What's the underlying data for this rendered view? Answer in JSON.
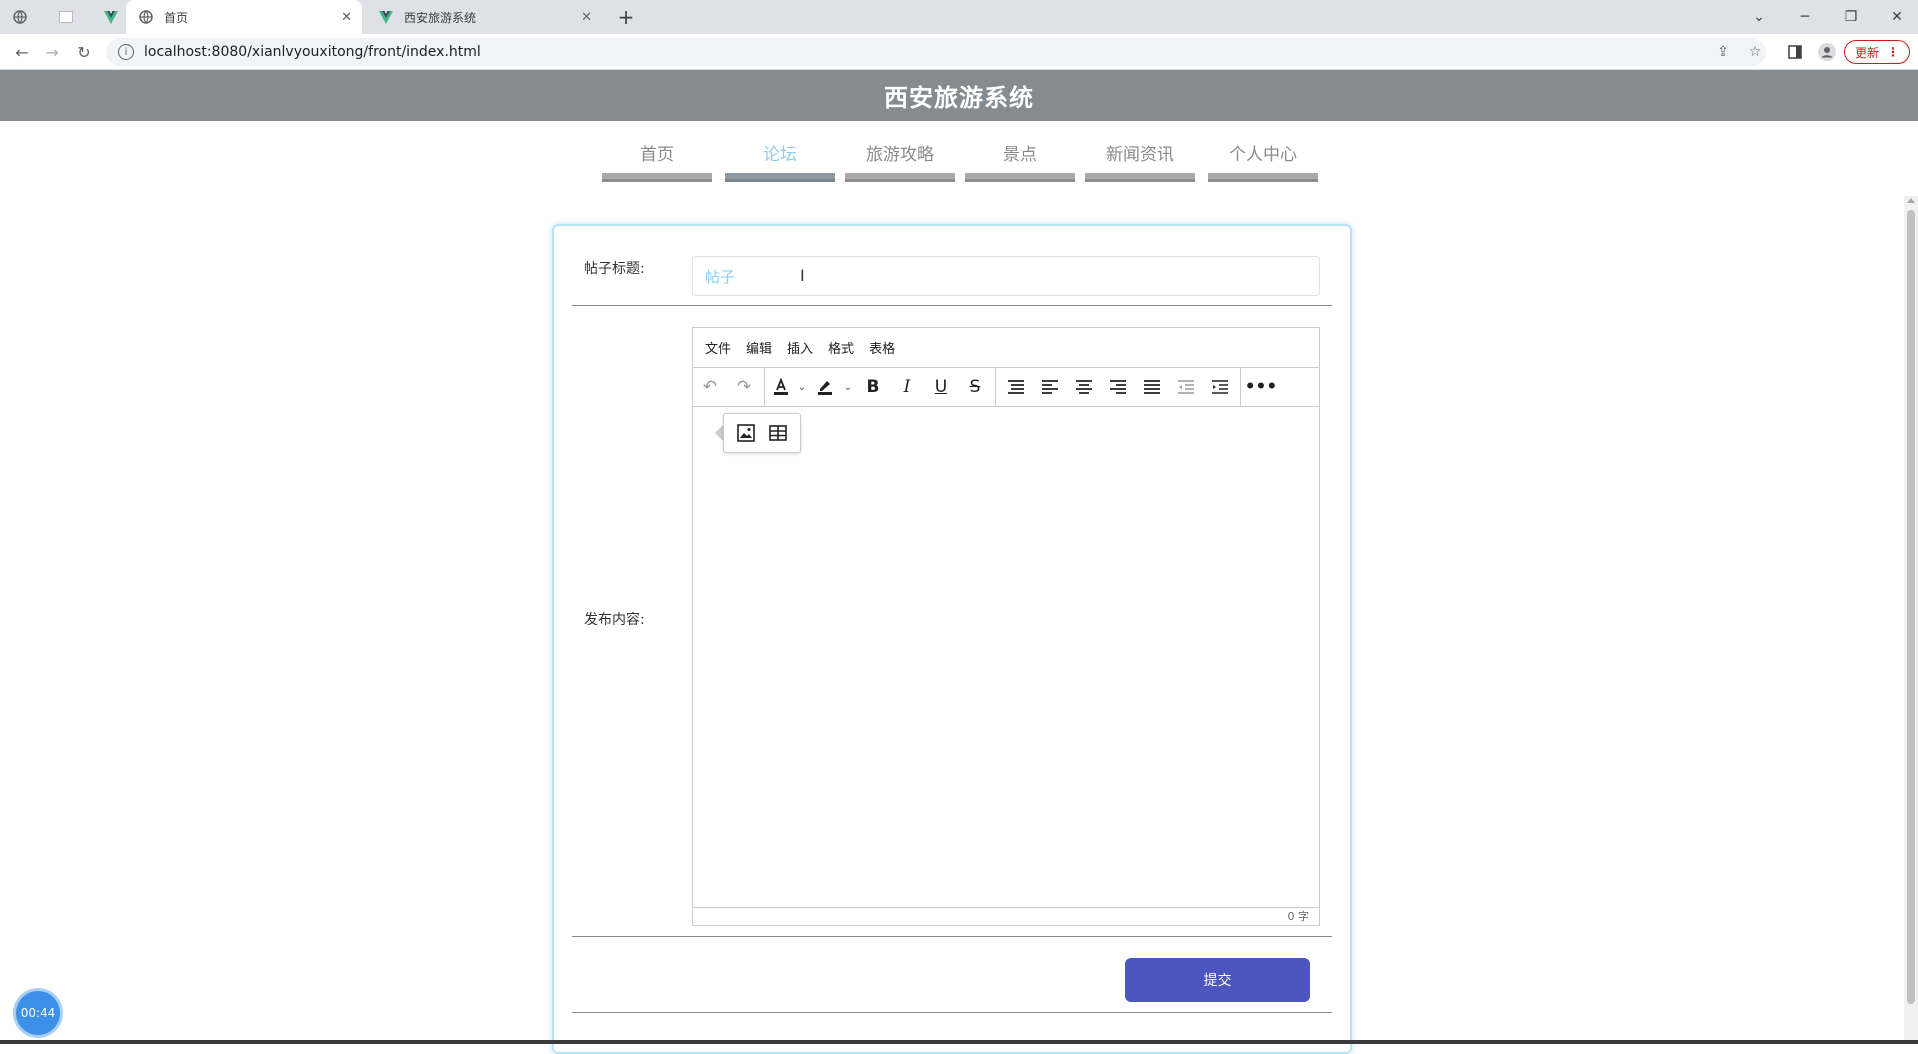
{
  "browser": {
    "tabs": [
      {
        "title": "",
        "icon": "globe-icon"
      },
      {
        "title": "",
        "icon": "blank-page-icon"
      },
      {
        "title": "",
        "icon": "vue-logo-icon"
      },
      {
        "title": "首页",
        "icon": "globe-icon",
        "active": true
      },
      {
        "title": "西安旅游系统",
        "icon": "vue-logo-icon"
      }
    ],
    "url": "localhost:8080/xianlvyouxitong/front/index.html",
    "update_label": "更新"
  },
  "site": {
    "title": "西安旅游系统",
    "nav": [
      {
        "label": "首页"
      },
      {
        "label": "论坛",
        "active": true
      },
      {
        "label": "旅游攻略"
      },
      {
        "label": "景点"
      },
      {
        "label": "新闻资讯"
      },
      {
        "label": "个人中心"
      }
    ]
  },
  "form": {
    "title_label": "帖子标题:",
    "title_value": "帖子",
    "content_label": "发布内容:",
    "submit_label": "提交"
  },
  "editor": {
    "menu": [
      "文件",
      "编辑",
      "插入",
      "格式",
      "表格"
    ],
    "word_count": "0 字"
  },
  "timer": "00:44",
  "colors": {
    "header_bg": "#858b8e",
    "nav_active": "#8ecdf0",
    "submit_bg": "#4d55bf",
    "card_border": "#b9e4f6"
  }
}
